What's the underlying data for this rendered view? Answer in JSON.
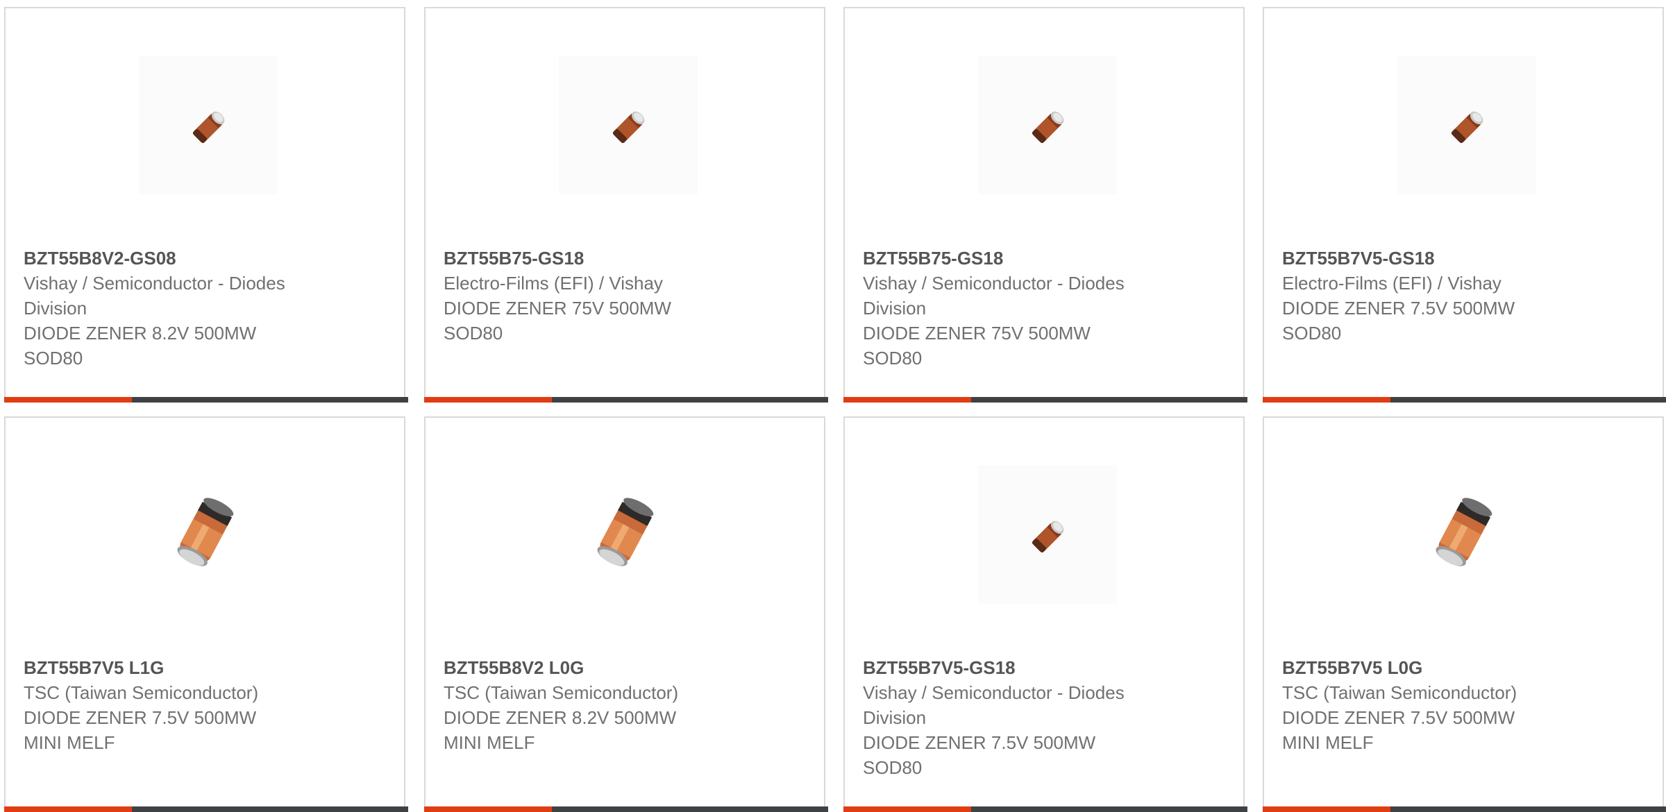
{
  "products": [
    {
      "part_number": "BZT55B8V2-GS08",
      "manufacturer_line1": "Vishay / Semiconductor - Diodes",
      "manufacturer_line2": "Division",
      "description": "DIODE ZENER 8.2V 500MW",
      "package": "SOD80",
      "image_icon": "diode-sod80-small-icon"
    },
    {
      "part_number": "BZT55B75-GS18",
      "manufacturer_line1": "Electro-Films (EFI) / Vishay",
      "manufacturer_line2": "",
      "description": "DIODE ZENER 75V 500MW",
      "package": "SOD80",
      "image_icon": "diode-sod80-small-icon"
    },
    {
      "part_number": "BZT55B75-GS18",
      "manufacturer_line1": "Vishay / Semiconductor - Diodes",
      "manufacturer_line2": "Division",
      "description": "DIODE ZENER 75V 500MW",
      "package": "SOD80",
      "image_icon": "diode-sod80-small-icon"
    },
    {
      "part_number": "BZT55B7V5-GS18",
      "manufacturer_line1": "Electro-Films (EFI) / Vishay",
      "manufacturer_line2": "",
      "description": "DIODE ZENER 7.5V 500MW",
      "package": "SOD80",
      "image_icon": "diode-sod80-small-icon"
    },
    {
      "part_number": "BZT55B7V5 L1G",
      "manufacturer_line1": "TSC (Taiwan Semiconductor)",
      "manufacturer_line2": "",
      "description": "DIODE ZENER 7.5V 500MW",
      "package": "MINI MELF",
      "image_icon": "diode-mini-melf-icon"
    },
    {
      "part_number": "BZT55B8V2 L0G",
      "manufacturer_line1": "TSC (Taiwan Semiconductor)",
      "manufacturer_line2": "",
      "description": "DIODE ZENER 8.2V 500MW",
      "package": "MINI MELF",
      "image_icon": "diode-mini-melf-icon"
    },
    {
      "part_number": "BZT55B7V5-GS18",
      "manufacturer_line1": "Vishay / Semiconductor - Diodes",
      "manufacturer_line2": "Division",
      "description": "DIODE ZENER 7.5V 500MW",
      "package": "SOD80",
      "image_icon": "diode-sod80-small-icon"
    },
    {
      "part_number": "BZT55B7V5 L0G",
      "manufacturer_line1": "TSC (Taiwan Semiconductor)",
      "manufacturer_line2": "",
      "description": "DIODE ZENER 7.5V 500MW",
      "package": "MINI MELF",
      "image_icon": "diode-mini-melf-icon"
    }
  ],
  "colors": {
    "accent": "#e13d12",
    "bar_dark": "#3f4244",
    "text": "#707070",
    "part_number": "#555555",
    "border": "#d9d9d9"
  }
}
